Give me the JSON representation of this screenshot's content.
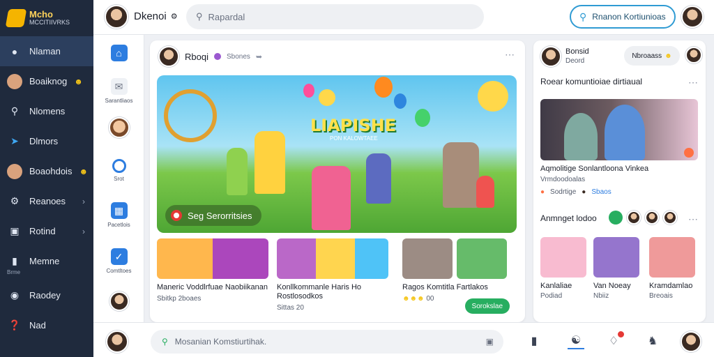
{
  "sidebar": {
    "logo_title": "Mcho",
    "logo_sub": "MCCITIIVRKS",
    "items": [
      {
        "label": "Nlaman",
        "icon": "user-icon",
        "active": true
      },
      {
        "label": "Boaiknog",
        "icon": "avatar",
        "badge": true
      },
      {
        "label": "Nlomens",
        "icon": "search-people-icon"
      },
      {
        "label": "Dlmors",
        "icon": "bird-icon"
      },
      {
        "label": "Boaohdois",
        "icon": "avatar",
        "badge": true
      },
      {
        "label": "Reanoes",
        "icon": "gear-icon",
        "chevron": true
      },
      {
        "label": "Rotind",
        "icon": "video-icon",
        "chevron": true
      },
      {
        "label": "Memne",
        "icon": "bookmark-icon",
        "mini": "Brme"
      },
      {
        "label": "Raodey",
        "icon": "globe-icon"
      },
      {
        "label": "Nad",
        "icon": "help-icon"
      }
    ]
  },
  "topbar": {
    "username": "Dkenoi",
    "search_placeholder": "Rapardal",
    "cta_label": "Rnanon Kortiunioas"
  },
  "rail": {
    "items": [
      {
        "label": "",
        "icon": "home-icon"
      },
      {
        "label": "Sarantliaos",
        "icon": "mail-icon"
      },
      {
        "label": "",
        "icon": "avatar"
      },
      {
        "label": "Srot",
        "icon": "circle-icon"
      },
      {
        "label": "Pacetlois",
        "icon": "photos-icon"
      },
      {
        "label": "Comtltoes",
        "icon": "check-icon"
      },
      {
        "label": "",
        "icon": "avatar"
      }
    ]
  },
  "post": {
    "author": "Rboqi",
    "meta": "Sbones",
    "hero_title": "LIAPISHE",
    "hero_sub": "PON KALOWTAEE",
    "hero_chip": "Seg Serorritsies",
    "thumbs": [
      {
        "title": "Maneric Voddlrfuae Naobiikanan",
        "meta": "Sbitkp  2boaes"
      },
      {
        "title": "Konllkommanle Haris Ho Rostlosodkos",
        "meta": "Sittas  20"
      },
      {
        "title": "Ragos Komtitla Fartlakos",
        "meta": "00"
      }
    ],
    "green_button": "Sorokslae"
  },
  "right_panel": {
    "user_name": "Bonsid",
    "user_sub": "Deord",
    "mentions_label": "Nbroaass",
    "section_title": "Roear komuntioiae dirtiaual",
    "video_title": "Aqmolitige Sonlantloona Vinkea",
    "video_sub": "Vrmdoodoalas",
    "stats_1": "Sodrtige",
    "stats_2": "Sbaos",
    "friends_title": "Anmnget lodoo",
    "friends": [
      {
        "name": "Kanlaliae",
        "sub": "Podiad"
      },
      {
        "name": "Van  Noeay",
        "sub": "Nbiiz"
      },
      {
        "name": "Kramdamlao",
        "sub": "Breoais"
      }
    ]
  },
  "bottom": {
    "compose_placeholder": "Mosanian Komstiurtihak."
  }
}
